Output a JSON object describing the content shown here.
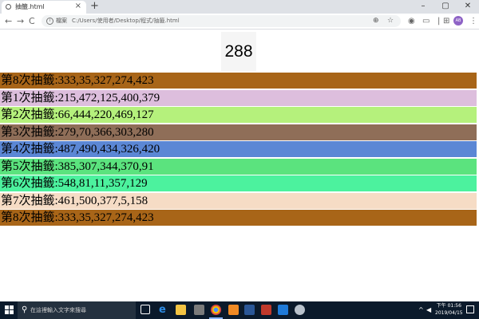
{
  "browser": {
    "tab": {
      "title": "抽籤.html",
      "close": "×"
    },
    "new_tab": "+",
    "window_controls": [
      "–",
      "▢",
      "✕"
    ],
    "nav": {
      "back": "←",
      "forward": "→",
      "reload": "C"
    },
    "address": {
      "info_label": "檔案",
      "url": "C:/Users/使用者/Desktop/程式/抽籤.html"
    },
    "profile_initials": "AB",
    "icons": {
      "zoom": "zoom-icon",
      "bookmark": "star-icon",
      "menu": "menu-icon"
    }
  },
  "page": {
    "result_number": "288",
    "draws": [
      {
        "text": "第8次抽籤:333,35,327,274,423",
        "color": "#a86518"
      },
      {
        "text": "第1次抽籤:215,472,125,400,379",
        "color": "#ddbedd"
      },
      {
        "text": "第2次抽籤:66,444,220,469,127",
        "color": "#b5f17c"
      },
      {
        "text": "第3次抽籤:279,70,366,303,280",
        "color": "#8f6e58"
      },
      {
        "text": "第4次抽籤:487,490,434,326,420",
        "color": "#5b87d5"
      },
      {
        "text": "第5次抽籤:385,307,344,370,91",
        "color": "#5be37e"
      },
      {
        "text": "第6次抽籤:548,81,11,357,129",
        "color": "#4cf29e"
      },
      {
        "text": "第7次抽籤:461,500,377,5,158",
        "color": "#f6dcc5"
      },
      {
        "text": "第8次抽籤:333,35,327,274,423",
        "color": "#a86518"
      }
    ]
  },
  "taskbar": {
    "search_placeholder": "在這裡輸入文字來搜尋",
    "clock_time": "下午 01:56",
    "clock_date": "2019/04/15",
    "tray_chevron": "^",
    "apps": [
      "task-view-icon",
      "edge-icon",
      "file-explorer-icon",
      "store-icon",
      "chrome-icon",
      "app-icon",
      "word-icon",
      "powerpoint-icon",
      "vscode-icon",
      "paint-icon"
    ]
  }
}
